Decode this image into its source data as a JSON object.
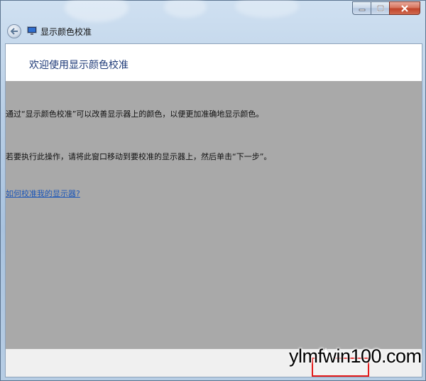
{
  "window": {
    "title": "显示颜色校准",
    "caption_buttons": [
      "minimize-icon",
      "maximize-icon",
      "close-icon"
    ]
  },
  "page": {
    "heading": "欢迎使用显示颜色校准",
    "paragraph1": "通过“显示颜色校准”可以改善显示器上的颜色，以便更加准确地显示颜色。",
    "paragraph2": "若要执行此操作，请将此窗口移动到要校准的显示器上，然后单击“下一步”。",
    "help_link": "如何校准我的显示器?"
  },
  "footer": {
    "highlight_color": "#e31b1b"
  },
  "watermark": {
    "text": "ylmfwin100.com"
  },
  "colors": {
    "content_overlay": "#a9a9a9",
    "heading": "#1e3a78",
    "link": "#1d57b8"
  }
}
